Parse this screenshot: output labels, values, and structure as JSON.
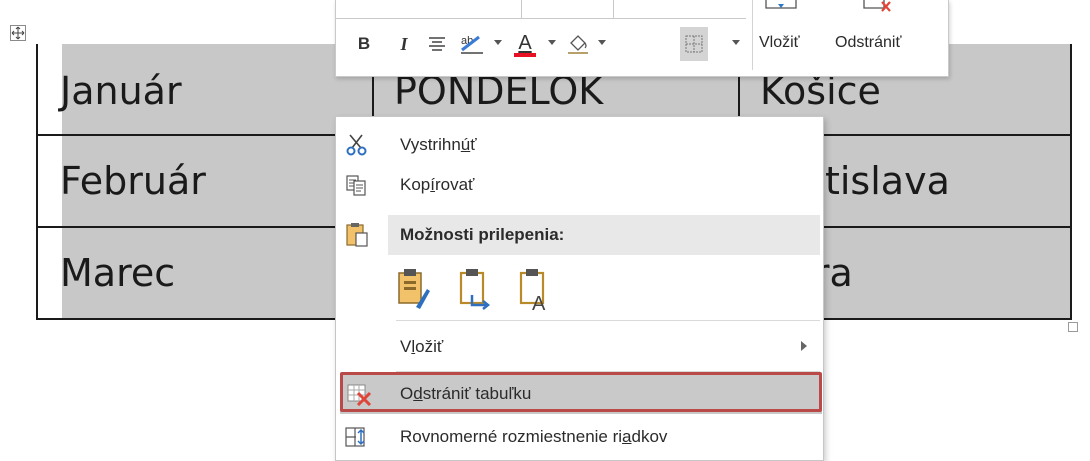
{
  "table": {
    "rows": [
      [
        "Január",
        "PONDELOK",
        "Košice"
      ],
      [
        "Február",
        "",
        "Bratislava"
      ],
      [
        "Marec",
        "",
        "Nitra"
      ]
    ]
  },
  "mini_toolbar": {
    "bold": "B",
    "italic": "I",
    "font_color_letter": "A",
    "insert_label": "Vložiť",
    "delete_label": "Odstrániť",
    "accent_color": "#e81123"
  },
  "context_menu": {
    "cut": {
      "pre": "Vystrihn",
      "u": "ú",
      "post": "ť",
      "icon": "scissors-icon"
    },
    "copy": {
      "pre": "Kop",
      "u": "í",
      "post": "rovať",
      "icon": "copy-icon"
    },
    "paste_options_header": "Možnosti prilepenia:",
    "insert": {
      "pre": "V",
      "u": "l",
      "post": "ožiť"
    },
    "delete_table": {
      "pre": "O",
      "u": "d",
      "post": "strániť tabuľku"
    },
    "distribute_rows": {
      "pre": "Rovnomerné rozmiestnenie ri",
      "u": "a",
      "post": "dkov"
    },
    "highlight_color": "#b94a48"
  }
}
